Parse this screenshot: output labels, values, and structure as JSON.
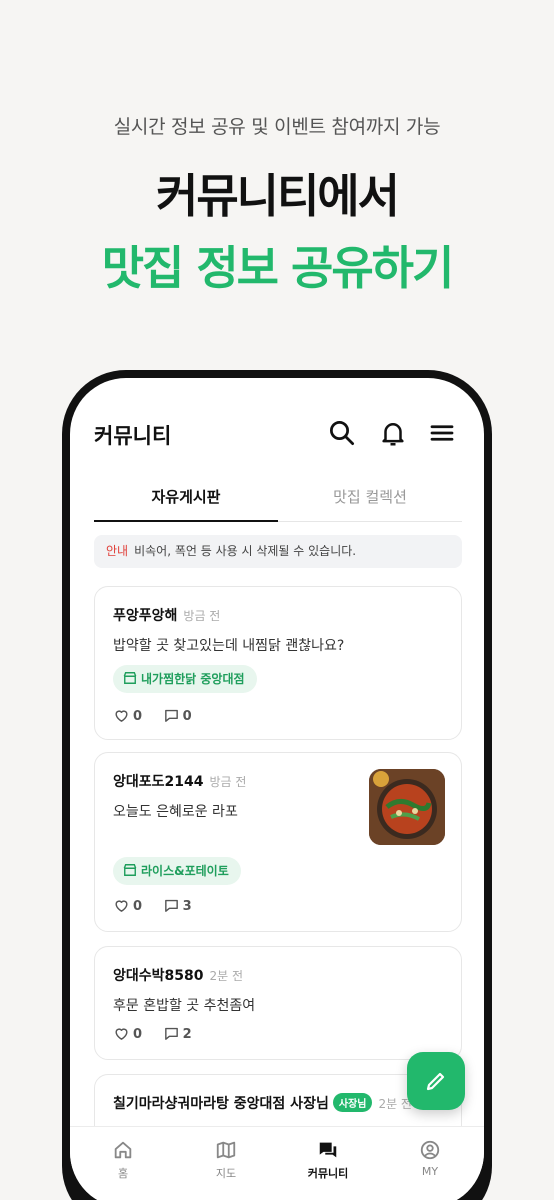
{
  "promo": {
    "subtitle": "실시간 정보 공유 및 이벤트 참여까지 가능",
    "title_line1": "커뮤니티에서",
    "title_line2": "맛집 정보 공유하기"
  },
  "appbar": {
    "title": "커뮤니티",
    "icons": [
      "search-icon",
      "bell-icon",
      "menu-icon"
    ]
  },
  "tabs": [
    {
      "label": "자유게시판",
      "active": true
    },
    {
      "label": "맛집 컬렉션",
      "active": false
    }
  ],
  "notice": {
    "tag": "안내",
    "text": "비속어, 폭언 등 사용 시 삭제될 수 있습니다."
  },
  "posts": [
    {
      "author": "푸앙푸앙해",
      "time": "방금 전",
      "text": "밥약할 곳 찾고있는데 내찜닭 괜찮나요?",
      "store": "내가찜한닭 중앙대점",
      "likes": "0",
      "comments": "0"
    },
    {
      "author": "앙대포도2144",
      "time": "방금 전",
      "text": "오늘도 은혜로운 라포",
      "store": "라이스&포테이토",
      "likes": "0",
      "comments": "3"
    },
    {
      "author": "앙대수박8580",
      "time": "2분 전",
      "text": "후문 혼밥할 곳 추천좀여",
      "likes": "0",
      "comments": "2"
    },
    {
      "author": "칠기마라샹궈마라탕 중앙대점 사장님",
      "badge": "사장님",
      "time": "2분 전"
    }
  ],
  "bottom_nav": [
    {
      "label": "홈",
      "icon": "home-icon",
      "active": false
    },
    {
      "label": "지도",
      "icon": "map-icon",
      "active": false
    },
    {
      "label": "커뮤니티",
      "icon": "chat-icon",
      "active": true
    },
    {
      "label": "MY",
      "icon": "profile-icon",
      "active": false
    }
  ],
  "colors": {
    "accent": "#22b86c",
    "notice_tag": "#e0403a",
    "background": "#f6f5f3"
  }
}
